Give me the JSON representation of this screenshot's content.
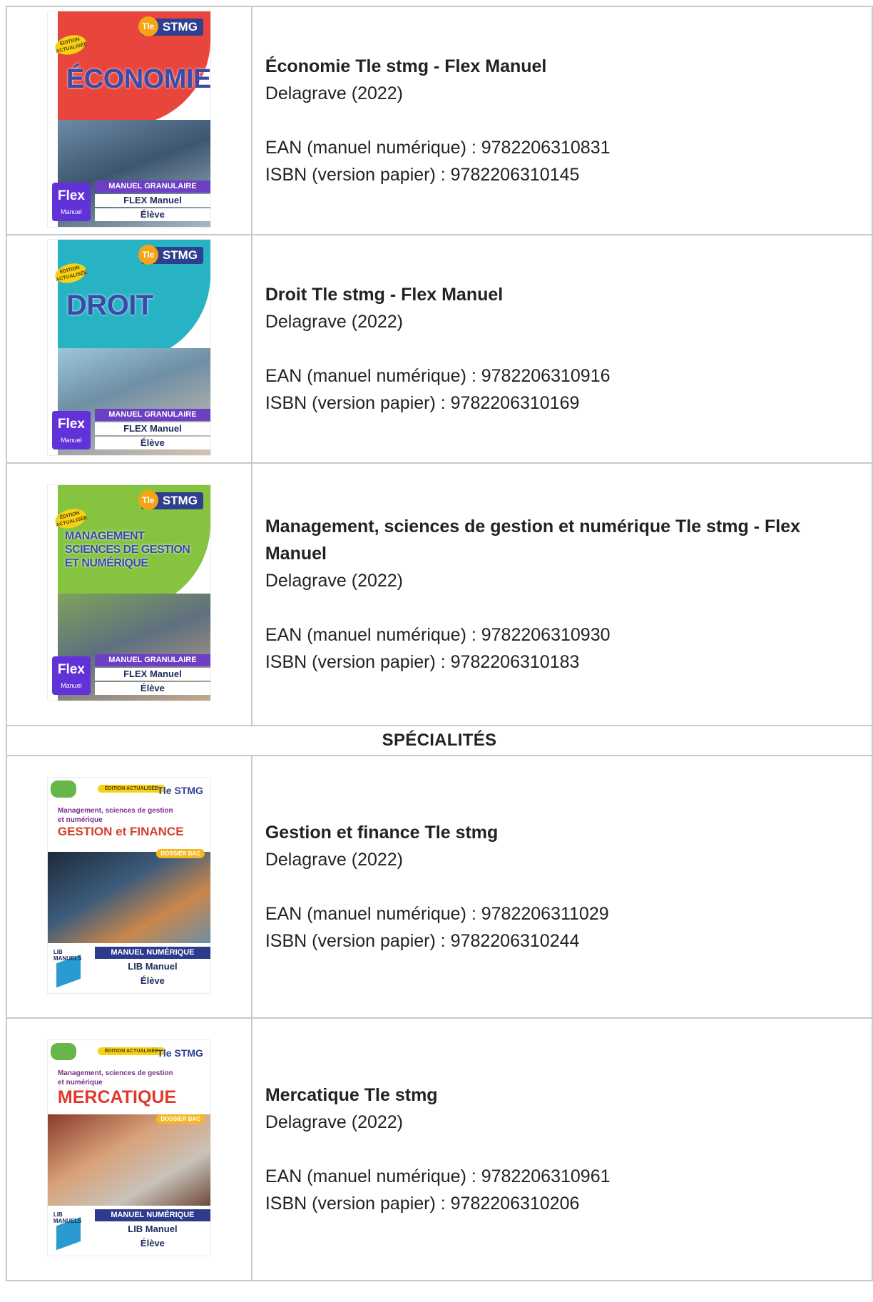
{
  "section_header": "SPÉCIALITÉS",
  "books": [
    {
      "title": "Économie Tle stmg - Flex Manuel",
      "publisher": "Delagrave (2022)",
      "ean": "EAN (manuel numérique) : 9782206310831",
      "isbn": "ISBN (version papier) : 9782206310145",
      "cover": {
        "level": "STMG",
        "badge": "ÉDITION ACTUALISÉE",
        "subject": "ÉCONOMIE",
        "strip": "MANUEL GRANULAIRE",
        "edition": "FLEX Manuel",
        "student": "Élève",
        "logo": "Flex",
        "logo_sub": "Manuel",
        "accent": "#e8453c"
      }
    },
    {
      "title": "Droit Tle stmg - Flex Manuel",
      "publisher": "Delagrave (2022)",
      "ean": "EAN (manuel numérique) : 9782206310916",
      "isbn": "ISBN (version papier) : 9782206310169",
      "cover": {
        "level": "STMG",
        "badge": "ÉDITION ACTUALISÉE",
        "subject": "DROIT",
        "strip": "MANUEL GRANULAIRE",
        "edition": "FLEX Manuel",
        "student": "Élève",
        "logo": "Flex",
        "logo_sub": "Manuel",
        "accent": "#27b3c4"
      }
    },
    {
      "title": "Management, sciences de gestion et numérique Tle stmg -  Flex Manuel",
      "publisher": "Delagrave (2022)",
      "ean": "EAN (manuel numérique) : 9782206310930",
      "isbn": "ISBN (version papier) : 9782206310183",
      "cover": {
        "level": "STMG",
        "badge": "ÉDITION ACTUALISÉE",
        "subject_l1": "MANAGEMENT",
        "subject_l2": "SCIENCES DE GESTION",
        "subject_l3": "ET NUMÉRIQUE",
        "strip": "MANUEL GRANULAIRE",
        "edition": "FLEX Manuel",
        "student": "Élève",
        "logo": "Flex",
        "logo_sub": "Manuel",
        "accent": "#86c440"
      }
    },
    {
      "title": "Gestion et finance Tle stmg",
      "publisher": "Delagrave (2022)",
      "ean": "EAN (manuel numérique) : 9782206311029",
      "isbn": "ISBN (version papier) : 9782206310244",
      "cover": {
        "level": "Tle STMG",
        "badge": "ÉDITION ACTUALISÉE",
        "head_l1": "Management, sciences de gestion",
        "head_l2": "et numérique",
        "subject": "GESTION et FINANCE",
        "tag": "DOSSIER BAC",
        "strip": "MANUEL NUMÉRIQUE",
        "edition": "LIB Manuel",
        "student": "Élève",
        "logo": "LIB MANUELS"
      }
    },
    {
      "title": "Mercatique Tle stmg",
      "publisher": "Delagrave (2022)",
      "ean": "EAN (manuel numérique) : 9782206310961",
      "isbn": "ISBN (version papier) : 9782206310206",
      "cover": {
        "level": "Tle STMG",
        "badge": "ÉDITION ACTUALISÉE",
        "head_l1": "Management, sciences de gestion",
        "head_l2": "et numérique",
        "subject": "MERCATIQUE",
        "tag": "DOSSIER BAC",
        "strip": "MANUEL NUMÉRIQUE",
        "edition": "LIB Manuel",
        "student": "Élève",
        "logo": "LIB MANUELS"
      }
    }
  ]
}
